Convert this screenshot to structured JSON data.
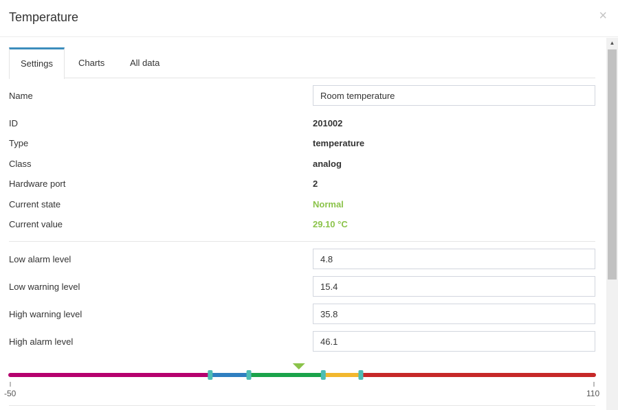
{
  "dialog": {
    "title": "Temperature",
    "close_glyph": "×"
  },
  "tabs": [
    {
      "label": "Settings",
      "active": true
    },
    {
      "label": "Charts",
      "active": false
    },
    {
      "label": "All data",
      "active": false
    }
  ],
  "settings": {
    "name": {
      "label": "Name",
      "value": "Room temperature"
    },
    "id": {
      "label": "ID",
      "value": "201002"
    },
    "type": {
      "label": "Type",
      "value": "temperature"
    },
    "class": {
      "label": "Class",
      "value": "analog"
    },
    "hardware_port": {
      "label": "Hardware port",
      "value": "2"
    },
    "current_state": {
      "label": "Current state",
      "value": "Normal"
    },
    "current_value": {
      "label": "Current value",
      "value": "29.10 °C"
    },
    "low_alarm": {
      "label": "Low alarm level",
      "value": "4.8"
    },
    "low_warning": {
      "label": "Low warning level",
      "value": "15.4"
    },
    "high_warning": {
      "label": "High warning level",
      "value": "35.8"
    },
    "high_alarm": {
      "label": "High alarm level",
      "value": "46.1"
    }
  },
  "scale": {
    "min": -50,
    "max": 110,
    "min_label": "-50",
    "max_label": "110",
    "current": 29.1,
    "thresholds": [
      4.8,
      15.4,
      35.8,
      46.1
    ],
    "colors": {
      "below_low_alarm": "#b5006e",
      "low_warning_band": "#2f7fc0",
      "normal_band": "#1aa34a",
      "high_warning_band": "#f2b72e",
      "above_high_alarm": "#c62828",
      "handle": "#4dbdb4",
      "marker": "#8bc34a"
    }
  },
  "colors": {
    "accent": "#3c8dbc",
    "status_normal": "#8bc34a"
  }
}
